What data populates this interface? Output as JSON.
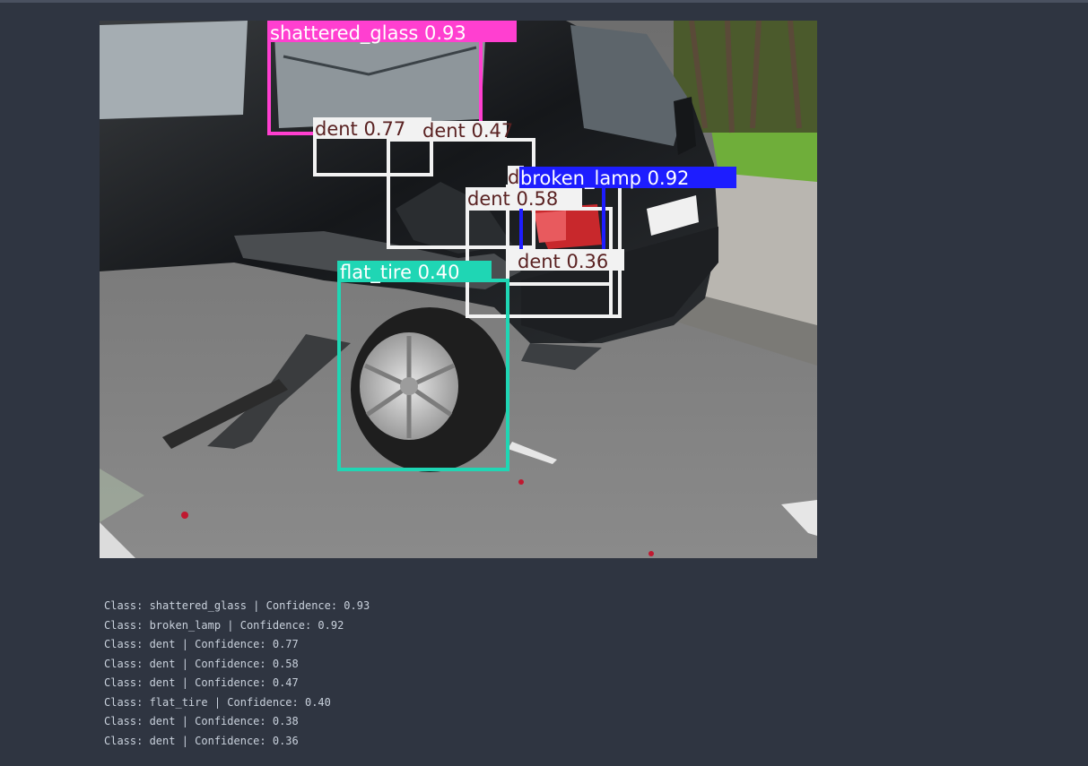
{
  "image": {
    "subject": "damaged-car-photo",
    "detections": [
      {
        "label": "shattered_glass 0.93",
        "cls": "shattered_glass",
        "conf": "0.93",
        "color": "#ff3fd0",
        "text_color": "#ffffff"
      },
      {
        "label": "broken_lamp 0.92",
        "cls": "broken_lamp",
        "conf": "0.92",
        "color": "#1d1dff",
        "text_color": "#ffffff"
      },
      {
        "label": "dent 0.77",
        "cls": "dent",
        "conf": "0.77",
        "color": "#f2f2f2",
        "text_color": "#5a2222"
      },
      {
        "label": "dent 0.58",
        "cls": "dent",
        "conf": "0.58",
        "color": "#f2f2f2",
        "text_color": "#5a2222"
      },
      {
        "label": "dent 0.47",
        "cls": "dent",
        "conf": "0.47",
        "color": "#f2f2f2",
        "text_color": "#5a2222"
      },
      {
        "label": "flat_tire 0.40",
        "cls": "flat_tire",
        "conf": "0.40",
        "color": "#1fd6b4",
        "text_color": "#ffffff"
      },
      {
        "label": "dent 0.38",
        "cls": "dent",
        "conf": "0.38",
        "color": "#f2f2f2",
        "text_color": "#5a2222"
      },
      {
        "label": "dent 0.36",
        "cls": "dent",
        "conf": "0.36",
        "color": "#f2f2f2",
        "text_color": "#5a2222"
      }
    ]
  },
  "output_lines": [
    "Class: shattered_glass | Confidence: 0.93",
    "Class: broken_lamp | Confidence: 0.92",
    "Class: dent | Confidence: 0.77",
    "Class: dent | Confidence: 0.58",
    "Class: dent | Confidence: 0.47",
    "Class: flat_tire | Confidence: 0.40",
    "Class: dent | Confidence: 0.38",
    "Class: dent | Confidence: 0.36"
  ],
  "colors": {
    "background": "#2f3541",
    "output_text": "#c9d1dc"
  }
}
